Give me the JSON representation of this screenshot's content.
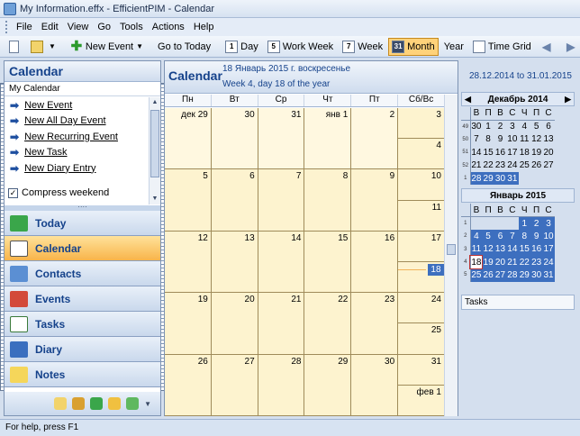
{
  "window": {
    "title": "My Information.effx - EfficientPIM - Calendar"
  },
  "menu": [
    "File",
    "Edit",
    "View",
    "Go",
    "Tools",
    "Actions",
    "Help"
  ],
  "toolbar": {
    "new_event": "New Event",
    "go_today": "Go to Today",
    "day": "Day",
    "work_week": "Work Week",
    "week": "Week",
    "month": "Month",
    "year": "Year",
    "time_grid": "Time Grid",
    "day_icon": "1",
    "work_week_icon": "5",
    "week_icon": "7",
    "month_icon": "31"
  },
  "left_panel": {
    "title": "Calendar",
    "subtitle": "My Calendar",
    "tasks": [
      "New Event",
      "New All Day Event",
      "New Recurring Event",
      "New Task",
      "New Diary Entry"
    ],
    "compress_label": "Compress weekend"
  },
  "nav": [
    "Today",
    "Calendar",
    "Contacts",
    "Events",
    "Tasks",
    "Diary",
    "Notes"
  ],
  "calendar": {
    "title": "Calendar",
    "current_date": "18 Январь 2015 г. воскресенье",
    "week_info": "Week 4, day 18 of the year",
    "range": "28.12.2014 to 31.01.2015",
    "day_headers": [
      "Пн",
      "Вт",
      "Ср",
      "Чт",
      "Пт",
      "Сб/Вс"
    ],
    "weeks": [
      [
        "дек 29",
        "30",
        "31",
        "янв 1",
        "2",
        "3",
        "4"
      ],
      [
        "5",
        "6",
        "7",
        "8",
        "9",
        "10",
        "11"
      ],
      [
        "12",
        "13",
        "14",
        "15",
        "16",
        "17",
        "18"
      ],
      [
        "19",
        "20",
        "21",
        "22",
        "23",
        "24",
        "25"
      ],
      [
        "26",
        "27",
        "28",
        "29",
        "30",
        "31",
        "фев 1"
      ]
    ]
  },
  "mini_cal_dec": {
    "title": "Декабрь 2014",
    "headers": [
      "В",
      "П",
      "В",
      "С",
      "Ч",
      "П",
      "С"
    ],
    "rows": [
      {
        "wk": "49",
        "days": [
          "30",
          "1",
          "2",
          "3",
          "4",
          "5",
          "6"
        ]
      },
      {
        "wk": "50",
        "days": [
          "7",
          "8",
          "9",
          "10",
          "11",
          "12",
          "13"
        ]
      },
      {
        "wk": "51",
        "days": [
          "14",
          "15",
          "16",
          "17",
          "18",
          "19",
          "20"
        ]
      },
      {
        "wk": "52",
        "days": [
          "21",
          "22",
          "23",
          "24",
          "25",
          "26",
          "27"
        ]
      },
      {
        "wk": "1",
        "days": [
          "28",
          "29",
          "30",
          "31",
          "",
          "",
          ""
        ]
      }
    ]
  },
  "mini_cal_jan": {
    "title": "Январь 2015",
    "headers": [
      "В",
      "П",
      "В",
      "С",
      "Ч",
      "П",
      "С"
    ],
    "rows": [
      {
        "wk": "1",
        "days": [
          "",
          "",
          "",
          "",
          "1",
          "2",
          "3"
        ]
      },
      {
        "wk": "2",
        "days": [
          "4",
          "5",
          "6",
          "7",
          "8",
          "9",
          "10"
        ]
      },
      {
        "wk": "3",
        "days": [
          "11",
          "12",
          "13",
          "14",
          "15",
          "16",
          "17"
        ]
      },
      {
        "wk": "4",
        "days": [
          "18",
          "19",
          "20",
          "21",
          "22",
          "23",
          "24"
        ]
      },
      {
        "wk": "5",
        "days": [
          "25",
          "26",
          "27",
          "28",
          "29",
          "30",
          "31"
        ]
      }
    ]
  },
  "tasks_title": "Tasks",
  "status": "For help, press F1"
}
